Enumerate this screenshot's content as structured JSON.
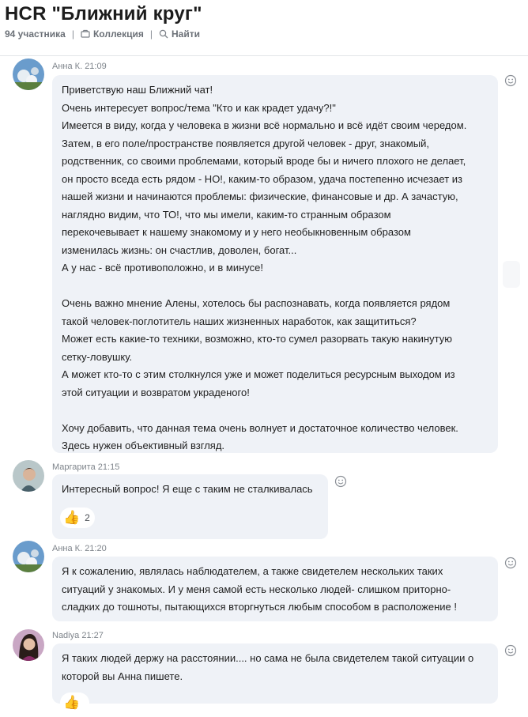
{
  "header": {
    "title": "HCR \"Ближний круг\"",
    "members": "94 участника",
    "separator": "|",
    "collection_label": "Коллекция",
    "search_label": "Найти"
  },
  "messages": [
    {
      "author": "Анна К.",
      "time": "21:09",
      "lines": [
        "Приветствую наш Ближний чат!",
        "Очень интересует вопрос/тема \"Кто и как крадет удачу?!\"",
        "Имеется в виду, когда у человека в жизни всё нормально и всё идёт своим чередом.",
        "Затем, в его поле/пространстве появляется другой человек - друг, знакомый,",
        "родственник, со своими проблемами, который вроде бы и ничего плохого не делает,",
        "он просто вседа есть рядом - НО!, каким-то образом, удача постепенно исчезает из",
        "нашей жизни и начинаются проблемы: физические, финансовые и др. А зачастую,",
        "наглядно видим, что ТО!, что мы имели, каким-то странным образом",
        "перекочевывает к нашему знакомому и у него необыкновенным образом",
        "изменилась жизнь: он счастлив, доволен, богат...",
        "А у нас - всё противоположно, и в минусе!",
        "",
        "Очень важно мнение Алены, хотелось бы распознавать, когда появляется рядом",
        "такой человек-поглотитель наших жизненных наработок, как защититься?",
        "Может есть какие-то техники, возможно, кто-то сумел разорвать такую накинутую",
        "сетку-ловушку.",
        "А может  кто-то с этим столкнулся уже и может поделиться ресурсным выходом из",
        "этой ситуации и возвратом украденого!",
        "",
        "Хочу добавить, что данная тема очень волнует и достаточное количество человек.",
        "Здесь нужен объективный взгляд."
      ]
    },
    {
      "author": "Маргарита",
      "time": "21:15",
      "lines": [
        "Интересный вопрос! Я еще с таким не сталкивалась"
      ],
      "reaction": {
        "emoji": "👍",
        "count": "2"
      }
    },
    {
      "author": "Анна К.",
      "time": "21:20",
      "lines": [
        "Я к сожалению, являлась наблюдателем, а также свидетелем нескольких таких",
        "ситуаций у знакомых.  И у меня самой есть несколько людей- слишком приторно-",
        "сладких до тошноты, пытающихся вторгнуться любым способом в расположение !"
      ]
    },
    {
      "author": "Nadiya",
      "time": "21:27",
      "lines": [
        "Я таких людей держу на расстоянии.... но сама не была свидетелем такой ситуации о",
        "которой вы Анна пишете."
      ],
      "reaction": {
        "emoji": "👍",
        "count": ""
      }
    }
  ],
  "icons": {
    "collection": "collection-icon",
    "search": "search-icon",
    "add_reaction": "smiley-icon",
    "thumbs_up": "thumbs-up-emoji"
  },
  "colors": {
    "bubble": "#eff2f7",
    "meta_text": "#7e848b",
    "title": "#1c1c1c"
  }
}
